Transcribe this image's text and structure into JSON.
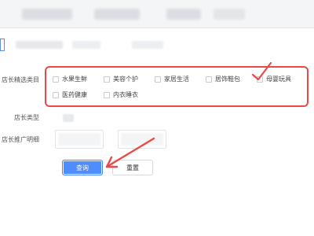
{
  "form": {
    "category_label": "店长精选类目",
    "category_options": [
      "水果生鲜",
      "美容个护",
      "家居生活",
      "居饰鞋包",
      "母婴玩具",
      "医药健康",
      "内衣睡衣"
    ],
    "type_label": "店长类型",
    "spread_label": "店长推广明细"
  },
  "buttons": {
    "query": "查询",
    "reset": "重置"
  },
  "annotations": {
    "color": "#e84a4a"
  }
}
